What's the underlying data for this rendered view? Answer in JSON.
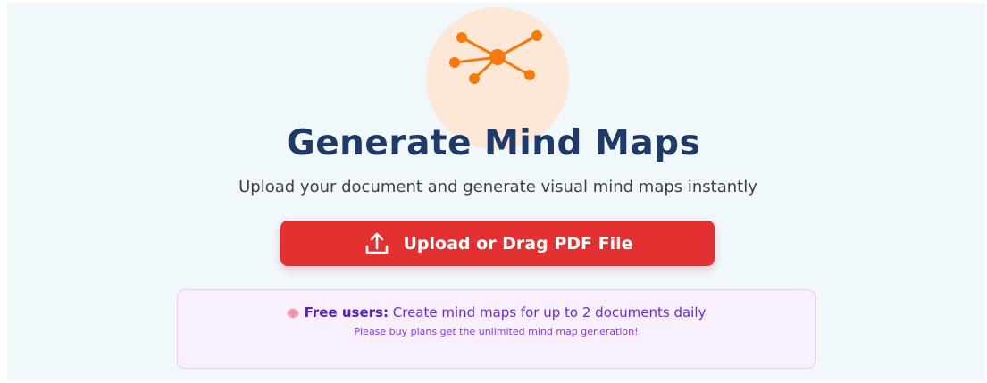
{
  "header": {
    "icon": "mind-map-icon",
    "title": "Generate Mind Maps",
    "subtitle": "Upload your document and generate visual mind maps instantly"
  },
  "upload": {
    "icon": "upload-icon",
    "label": "Upload or Drag PDF File"
  },
  "notice": {
    "emoji_icon": "brain-icon",
    "lead": "Free users:",
    "body": " Create mind maps for up to 2 documents daily",
    "hint": "Please buy plans get the unlimited mind map generation!"
  },
  "colors": {
    "accent": "#e33030",
    "icon_orange": "#f5790b",
    "title": "#1f3a66",
    "notice_bg": "#f8efff",
    "notice_text": "#6d28d9"
  }
}
